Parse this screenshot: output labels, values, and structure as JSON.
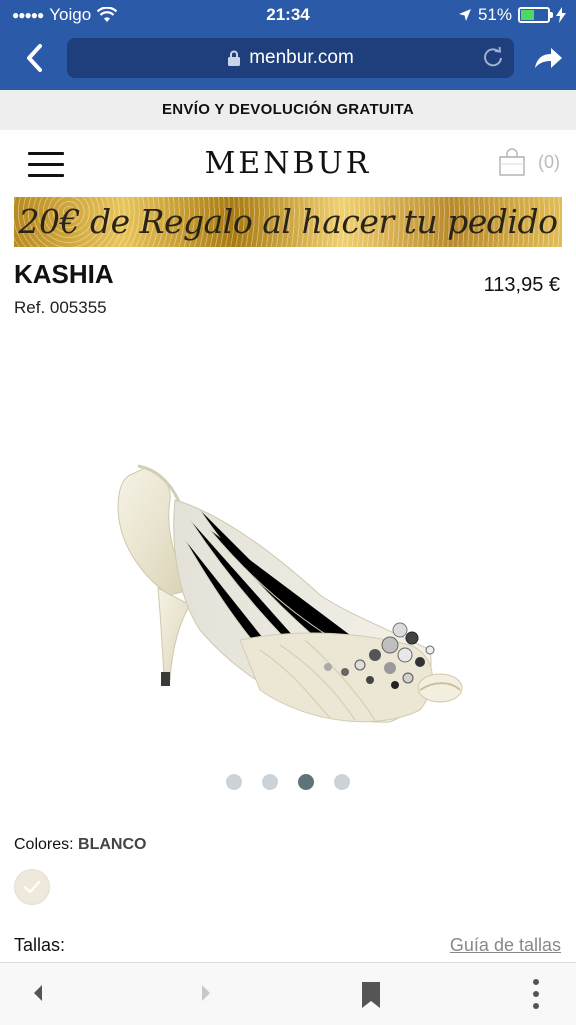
{
  "status_bar": {
    "signal": "●●●●●",
    "carrier": "Yoigo",
    "time": "21:34",
    "battery": "51%"
  },
  "browser": {
    "url": "menbur.com"
  },
  "promo": {
    "shipping": "ENVÍO Y DEVOLUCIÓN GRATUITA"
  },
  "header": {
    "logo": "MENBUR",
    "cart_count": "(0)"
  },
  "banner": {
    "text": "20€ de Regalo al hacer tu pedido"
  },
  "product": {
    "name": "KASHIA",
    "price": "113,95 €",
    "ref": "Ref. 005355",
    "image_count": 4,
    "active_image": 3
  },
  "options": {
    "colors_label": "Colores:",
    "color_value": "BLANCO",
    "sizes_label": "Tallas:",
    "size_guide": "Guía de tallas"
  },
  "colors": {
    "browser_bar": "#2b5aa8",
    "url_field": "#1f3f7c",
    "pager_active": "#5f7478",
    "pager_inactive": "#ccd3d8"
  }
}
